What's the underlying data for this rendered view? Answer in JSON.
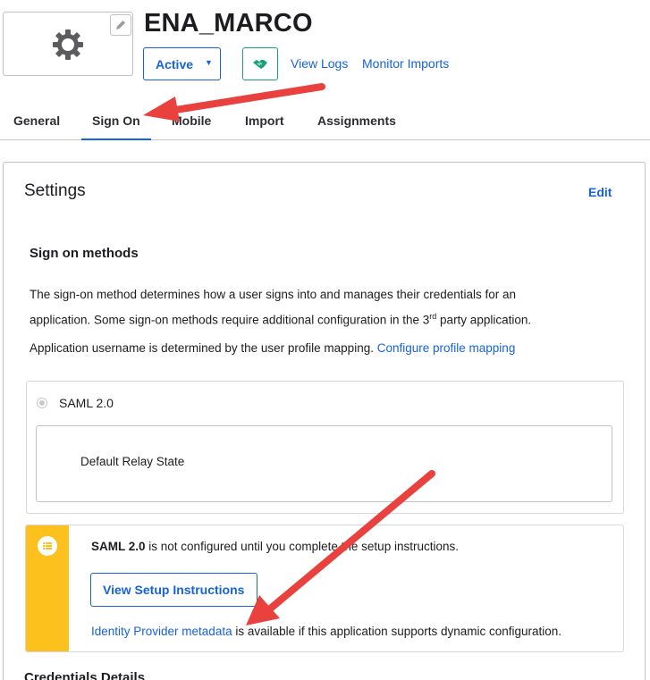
{
  "app": {
    "title": "ENA_MARCO",
    "logo_icon": "gear-icon",
    "edit_logo_icon": "pencil-icon"
  },
  "header": {
    "status_label": "Active",
    "status_caret": "▼",
    "push_icon": "handshake-icon",
    "view_logs_label": "View Logs",
    "monitor_imports_label": "Monitor Imports"
  },
  "tabs": [
    {
      "label": "General",
      "active": false
    },
    {
      "label": "Sign On",
      "active": true
    },
    {
      "label": "Mobile",
      "active": false
    },
    {
      "label": "Import",
      "active": false
    },
    {
      "label": "Assignments",
      "active": false
    }
  ],
  "settings": {
    "title": "Settings",
    "edit_label": "Edit",
    "section_title": "Sign on methods",
    "description_part1": "The sign-on method determines how a user signs into and manages their credentials for an",
    "description_part2": "application. Some sign-on methods require additional configuration in the 3",
    "description_sup": "rd",
    "description_part3": " party application.",
    "username_text": "Application username is determined by the user profile mapping.",
    "configure_mapping_link": "Configure profile mapping"
  },
  "saml": {
    "option_label": "SAML 2.0",
    "relay_state_label": "Default Relay State"
  },
  "callout": {
    "icon": "list-icon",
    "bold_text": "SAML 2.0",
    "text": " is not configured until you complete the setup instructions.",
    "button_label": "View Setup Instructions",
    "metadata_link": "Identity Provider metadata",
    "metadata_suffix": " is available if this application supports dynamic configuration."
  },
  "credentials": {
    "title": "Credentials Details"
  },
  "colors": {
    "accent": "#1662dd",
    "success": "#17a37a",
    "warning": "#fdc11e",
    "annotation": "#e8413e"
  }
}
